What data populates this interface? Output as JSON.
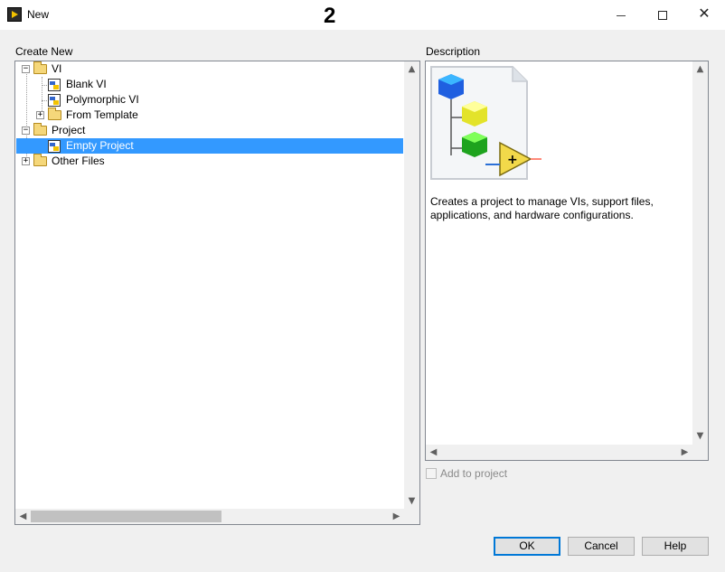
{
  "window": {
    "title": "New",
    "annotation": "2",
    "minimize_icon": "minimize-icon",
    "maximize_icon": "maximize-icon",
    "close_icon": "close-icon"
  },
  "create_new": {
    "label": "Create New",
    "tree": [
      {
        "label": "VI",
        "icon": "folder-open-icon",
        "expander": "−"
      },
      {
        "label": "Blank VI",
        "icon": "vi-icon"
      },
      {
        "label": "Polymorphic VI",
        "icon": "vi-icon"
      },
      {
        "label": "From Template",
        "icon": "folder-icon",
        "expander": "+"
      },
      {
        "label": "Project",
        "icon": "folder-open-icon",
        "expander": "−"
      },
      {
        "label": "Empty Project",
        "icon": "project-icon",
        "selected": true
      },
      {
        "label": "Other Files",
        "icon": "folder-icon",
        "expander": "+"
      }
    ]
  },
  "description": {
    "label": "Description",
    "text": "Creates a project to manage VIs, support files, applications, and hardware configurations."
  },
  "add_to_project": {
    "label": "Add to project",
    "checked": false,
    "enabled": false
  },
  "buttons": {
    "ok": "OK",
    "cancel": "Cancel",
    "help": "Help"
  },
  "colors": {
    "selection": "#3399ff",
    "default_button_border": "#0078d7"
  }
}
